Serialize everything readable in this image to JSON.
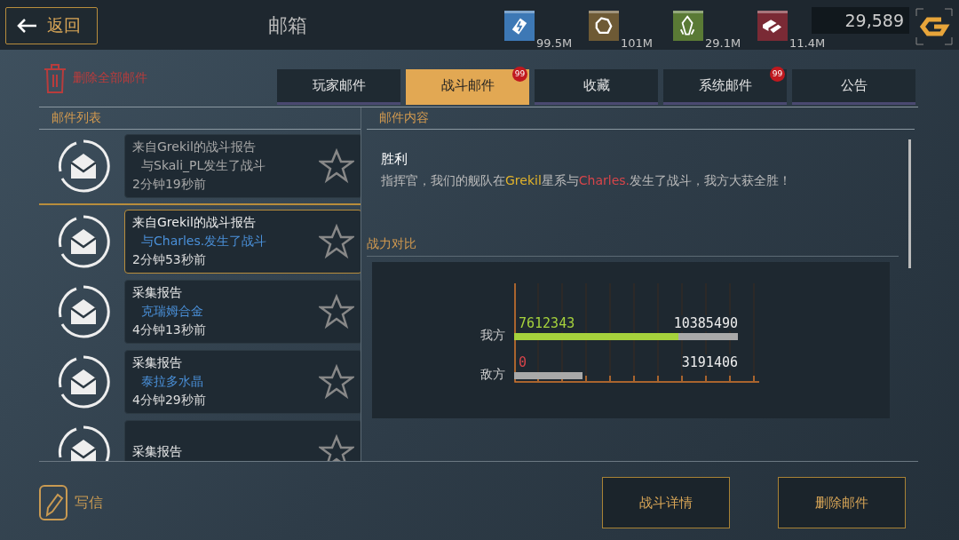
{
  "top_bar": {
    "back_label": "返回",
    "title": "邮箱",
    "resources": [
      {
        "kind": "energy",
        "amount": "99.5M"
      },
      {
        "kind": "ore",
        "amount": "101M"
      },
      {
        "kind": "crystal",
        "amount": "29.1M"
      },
      {
        "kind": "alloy",
        "amount": "11.4M"
      }
    ],
    "currency": "29,589"
  },
  "delete_all": "删除全部邮件",
  "tabs": [
    {
      "label": "玩家邮件",
      "selected": false
    },
    {
      "label": "战斗邮件",
      "selected": true,
      "badge": "99"
    },
    {
      "label": "收藏",
      "selected": false
    },
    {
      "label": "系统邮件",
      "selected": false,
      "badge": "99"
    },
    {
      "label": "公告",
      "selected": false
    }
  ],
  "mail_list": {
    "heading": "邮件列表",
    "items": [
      {
        "title": "来自Grekil的战斗报告",
        "subtitle": "与Skali_PL发生了战斗",
        "time": "2分钟19秒前",
        "read": true,
        "selected": false
      },
      {
        "title": "来自Grekil的战斗报告",
        "subtitle": "与Charles.发生了战斗",
        "time": "2分钟53秒前",
        "read": false,
        "selected": true
      },
      {
        "title": "采集报告",
        "subtitle": "克瑞姆合金",
        "time": "4分钟13秒前",
        "read": false,
        "selected": false
      },
      {
        "title": "采集报告",
        "subtitle": "泰拉多水晶",
        "time": "4分钟29秒前",
        "read": false,
        "selected": false
      },
      {
        "title": "采集报告",
        "read": false,
        "selected": false
      }
    ]
  },
  "mail_content": {
    "heading": "邮件内容",
    "title": "胜利",
    "body": [
      {
        "kind": "plain",
        "text": "指挥官，我们的舰队在"
      },
      {
        "kind": "ally",
        "text": "Grekil"
      },
      {
        "kind": "plain",
        "text": "星系与"
      },
      {
        "kind": "enemy",
        "text": "Charles."
      },
      {
        "kind": "plain",
        "text": "发生了战斗，我方大获全胜！"
      }
    ],
    "power_heading": "战力对比",
    "power_rows": [
      {
        "label": "我方",
        "value": "7612343",
        "total": "10385490",
        "level": 0.733,
        "color": "#a6d23c"
      },
      {
        "label": "敌方",
        "value": "0",
        "total": "3191406",
        "level": 0,
        "color": "#d8454a"
      }
    ]
  },
  "bottom": {
    "write_label": "写信",
    "buttons": [
      "战斗详情",
      "删除邮件"
    ]
  }
}
